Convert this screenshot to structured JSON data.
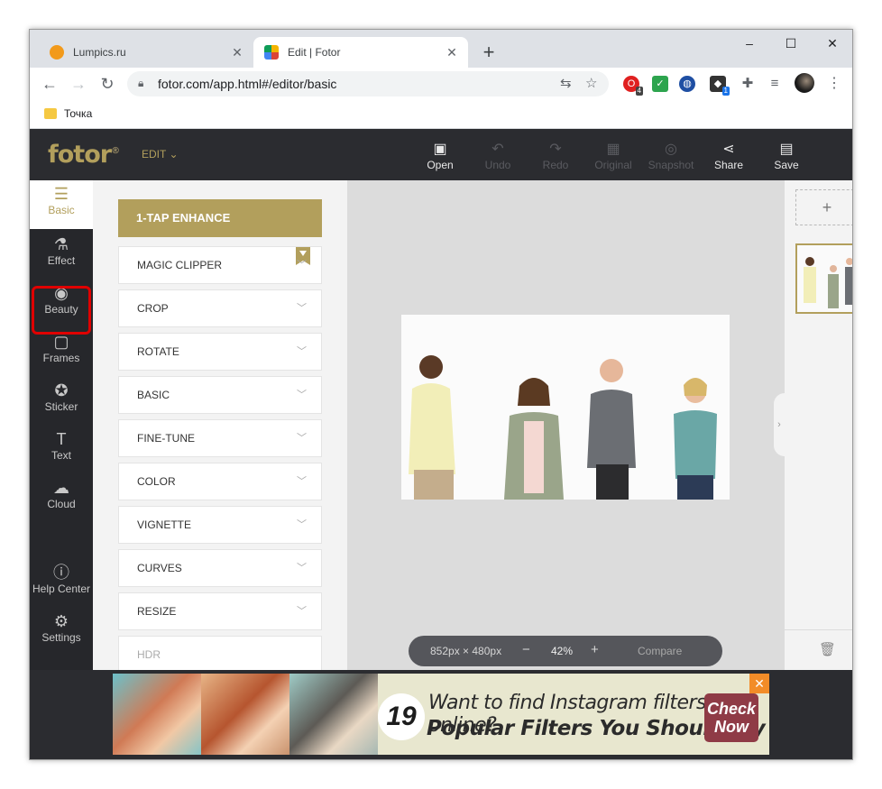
{
  "browser": {
    "tabs": [
      {
        "title": "Lumpics.ru",
        "icon": "orange-favicon",
        "active": false
      },
      {
        "title": "Edit | Fotor",
        "icon": "fotor-favicon",
        "active": true
      }
    ],
    "new_tab": "+",
    "window_controls": {
      "minimize": "–",
      "maximize": "☐",
      "close": "✕"
    },
    "url": "fotor.com/app.html#/editor/basic",
    "extensions": [
      {
        "name": "opera-extension-icon",
        "badge": "4",
        "color": "#e02020"
      },
      {
        "name": "checkmark-extension-icon",
        "badge": "",
        "color": "#2da44e"
      },
      {
        "name": "globe-extension-icon",
        "badge": "",
        "color": "#1f4fa3"
      },
      {
        "name": "cube-extension-icon",
        "badge": "1",
        "color": "#333333"
      }
    ],
    "bookmarks": [
      {
        "label": "Точка"
      }
    ]
  },
  "app": {
    "logo": "fotor",
    "logo_mark": "®",
    "edit_menu": "EDIT",
    "toolbar": [
      {
        "label": "Open",
        "icon": "open-icon",
        "enabled": true
      },
      {
        "label": "Undo",
        "icon": "undo-icon",
        "enabled": false
      },
      {
        "label": "Redo",
        "icon": "redo-icon",
        "enabled": false
      },
      {
        "label": "Original",
        "icon": "original-icon",
        "enabled": false
      },
      {
        "label": "Snapshot",
        "icon": "snapshot-icon",
        "enabled": false
      },
      {
        "label": "Share",
        "icon": "share-icon",
        "enabled": true
      },
      {
        "label": "Save",
        "icon": "save-icon",
        "enabled": true
      }
    ],
    "left_nav": [
      {
        "label": "Basic",
        "icon": "sliders-icon",
        "selected": true
      },
      {
        "label": "Effect",
        "icon": "flask-icon",
        "selected": false
      },
      {
        "label": "Beauty",
        "icon": "eye-icon",
        "selected": false,
        "highlighted": true
      },
      {
        "label": "Frames",
        "icon": "frame-icon",
        "selected": false
      },
      {
        "label": "Sticker",
        "icon": "star-icon",
        "selected": false
      },
      {
        "label": "Text",
        "icon": "text-icon",
        "selected": false
      },
      {
        "label": "Cloud",
        "icon": "cloud-icon",
        "selected": false
      },
      {
        "label": "Help Center",
        "icon": "help-icon",
        "selected": false
      },
      {
        "label": "Settings",
        "icon": "gear-icon",
        "selected": false
      }
    ],
    "enhance_button": "1-TAP ENHANCE",
    "tools": [
      "MAGIC CLIPPER",
      "CROP",
      "ROTATE",
      "BASIC",
      "FINE-TUNE",
      "COLOR",
      "VIGNETTE",
      "CURVES",
      "RESIZE",
      "HDR"
    ],
    "canvas": {
      "dimensions": "852px × 480px",
      "zoom": "42%",
      "zoom_out": "−",
      "zoom_in": "+",
      "compare": "Compare"
    },
    "right_panel": {
      "add": "+"
    },
    "accent_color": "#b29f5c"
  },
  "ad": {
    "number": "19",
    "line1": "Want to find Instagram filters online?",
    "line2": "Popular Filters You Should Try",
    "cta": "Check Now",
    "close": "✕"
  }
}
